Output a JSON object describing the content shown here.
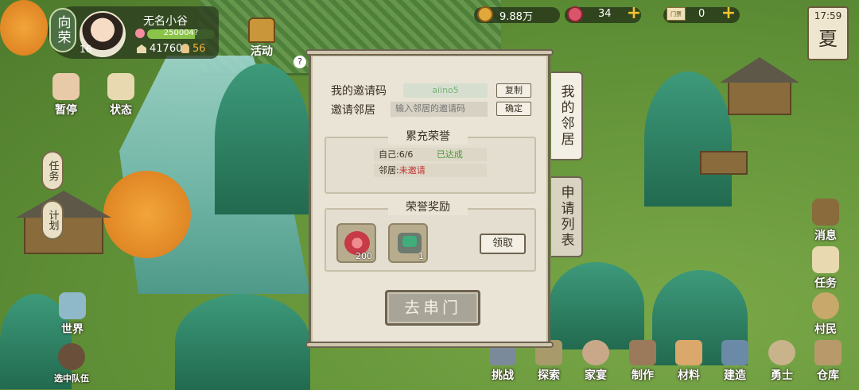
{
  "player": {
    "rank_label": "向荣",
    "name": "无名小谷",
    "level": "16",
    "exp": "250004?",
    "houses": "41760",
    "villagers": "56"
  },
  "resources": {
    "coins": "9.88万",
    "flowers": "34",
    "tickets": "0",
    "ticket_label": "门票"
  },
  "clock": {
    "time": "17:59",
    "season": "夏"
  },
  "left_menu": {
    "pause": "暂停",
    "status": "状态",
    "task": "任务",
    "plan": "计划",
    "world": "世界",
    "team": "选中队伍"
  },
  "activity": "活动",
  "help": "?",
  "right_menu": {
    "messages": "消息",
    "tasks": "任务",
    "villagers": "村民"
  },
  "bottom_menu": [
    "挑战",
    "探索",
    "家宴",
    "制作",
    "材料",
    "建造",
    "勇士",
    "仓库"
  ],
  "dialog": {
    "my_code_label": "我的邀请码",
    "my_code": "aiino5",
    "copy": "复制",
    "invite_label": "邀请邻居",
    "invite_placeholder": "输入邻居的邀请码",
    "confirm": "确定",
    "honor_title": "累充荣誉",
    "self_label": "自己:",
    "self_value": "6/6",
    "self_status": "已达成",
    "neighbor_label": "邻居:",
    "neighbor_status": "未邀请",
    "reward_title": "荣誉奖励",
    "reward1_count": "200",
    "reward2_count": "1",
    "claim": "领取",
    "go_button": "去串门"
  },
  "tabs": {
    "my_neighbors": "我的邻居",
    "apply_list": "申请列表"
  }
}
